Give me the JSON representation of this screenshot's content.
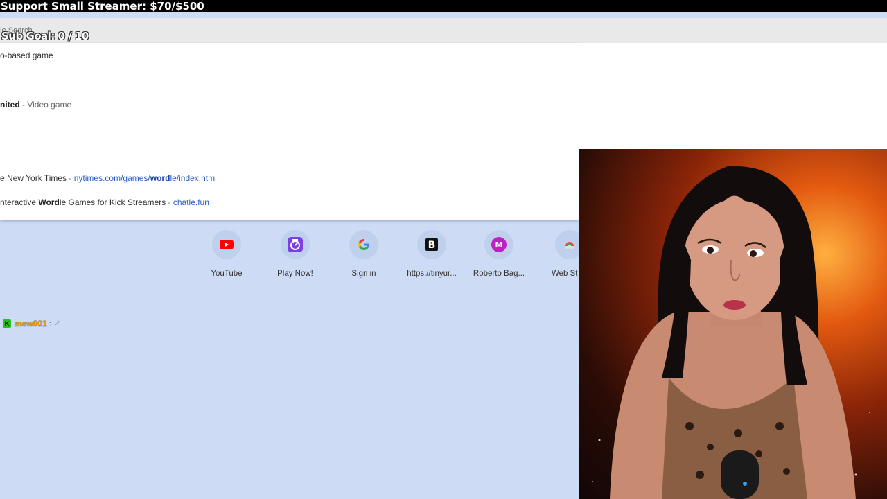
{
  "overlay": {
    "banner": "Support Small Streamer: $70/$500",
    "sub_goal": "Sub Goal:  0 / 10"
  },
  "omnibox": {
    "placeholder": "gle Search"
  },
  "suggestions": [
    {
      "bold": "",
      "text": "o-based game",
      "sep": "",
      "dim": "",
      "url_pre": "",
      "url_bold": "",
      "url_post": ""
    },
    {
      "bold": "nited",
      "text": "",
      "sep": " - ",
      "dim": "Video game",
      "url_pre": "",
      "url_bold": "",
      "url_post": ""
    },
    {
      "bold": "",
      "text": "e New York Times",
      "sep": " - ",
      "dim": "",
      "url_pre": "nytimes.com/games/",
      "url_bold": "word",
      "url_post": "le/index.html"
    },
    {
      "bold": "",
      "text": "nteractive ",
      "bold2": "Word",
      "text2": "le Games for Kick Streamers",
      "sep": " - ",
      "dim": "",
      "url_pre": "chatle.fun",
      "url_bold": "",
      "url_post": ""
    }
  ],
  "shortcuts": [
    {
      "label": "YouTube",
      "icon": "youtube-icon"
    },
    {
      "label": "Play Now!",
      "icon": "play-now-icon"
    },
    {
      "label": "Sign in",
      "icon": "google-icon"
    },
    {
      "label": "https://tinyur...",
      "icon": "b-logo-icon"
    },
    {
      "label": "Roberto Bag...",
      "icon": "avatar-m-icon"
    },
    {
      "label": "Web St",
      "icon": "chrome-web-store-icon"
    }
  ],
  "chat": {
    "badge": "K",
    "username": "mew001",
    "colon": ":"
  },
  "colors": {
    "banner_bg": "#000000",
    "page_bg": "#cddcf4",
    "link": "#2b61c4",
    "chat_user": "#e3a313",
    "badge_green": "#26c21b"
  }
}
